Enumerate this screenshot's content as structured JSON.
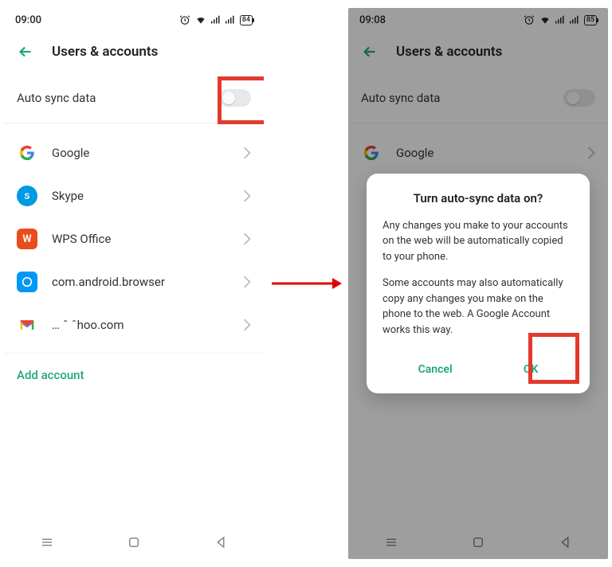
{
  "left": {
    "time": "09:00",
    "battery": "84",
    "header": "Users & accounts",
    "sync_label": "Auto sync data",
    "accounts": [
      {
        "label": "Google"
      },
      {
        "label": "Skype"
      },
      {
        "label": "WPS Office"
      },
      {
        "label": "com.android.browser"
      },
      {
        "label": "…              ˆ  ˆhoo.com"
      }
    ],
    "add_account": "Add account"
  },
  "right": {
    "time": "09:08",
    "battery": "85",
    "header": "Users & accounts",
    "sync_label": "Auto sync data",
    "visible_account": "Google",
    "dialog": {
      "title": "Turn auto-sync data on?",
      "para1": "Any changes you make to your accounts on the web will be automatically copied to your phone.",
      "para2": "Some accounts may also automatically copy any changes you make on the phone to the web. A Google Account works this way.",
      "cancel": "Cancel",
      "ok": "OK"
    }
  },
  "highlight_color": "#e13a2e",
  "accent_color": "#20a878"
}
